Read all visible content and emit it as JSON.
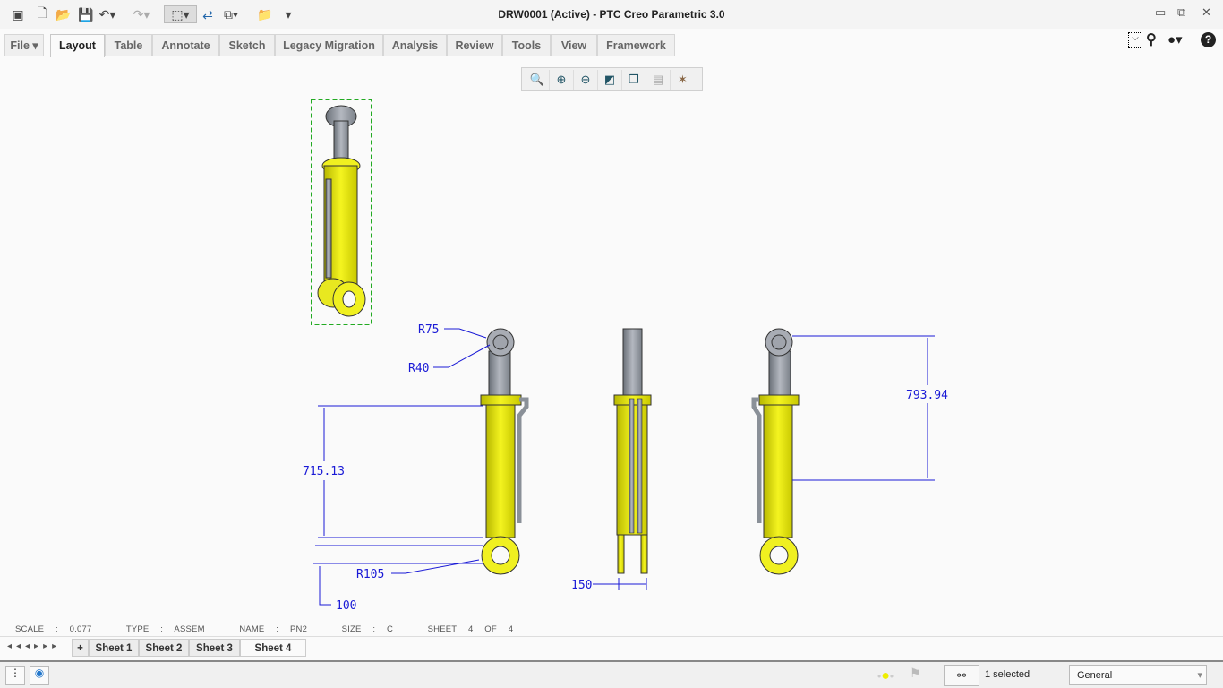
{
  "window": {
    "title": "DRW0001 (Active) - PTC Creo Parametric 3.0"
  },
  "ribbon": {
    "tabs": [
      {
        "label": "File ▾"
      },
      {
        "label": "Layout"
      },
      {
        "label": "Table"
      },
      {
        "label": "Annotate"
      },
      {
        "label": "Sketch"
      },
      {
        "label": "Legacy Migration"
      },
      {
        "label": "Analysis"
      },
      {
        "label": "Review"
      },
      {
        "label": "Tools"
      },
      {
        "label": "View"
      },
      {
        "label": "Framework"
      }
    ],
    "active": "Layout"
  },
  "drawing": {
    "dimensions": {
      "r75": "R75",
      "r40": "R40",
      "d715": "715.13",
      "r105": "R105",
      "d100": "100",
      "d150": "150",
      "d793": "793.94"
    },
    "colors": {
      "dimension": "#1a1ad6",
      "body": "#f0f020",
      "rod": "#9aa0a8"
    }
  },
  "sheet_info": {
    "scale": "SCALE : 0.077",
    "type": "TYPE : ASSEM",
    "name": "NAME : PN2",
    "size": "SIZE : C",
    "sheet": "SHEET 4  OF 4"
  },
  "sheets": [
    "Sheet 1",
    "Sheet 2",
    "Sheet 3",
    "Sheet 4"
  ],
  "status": {
    "selected": "1 selected",
    "filter": "General"
  }
}
